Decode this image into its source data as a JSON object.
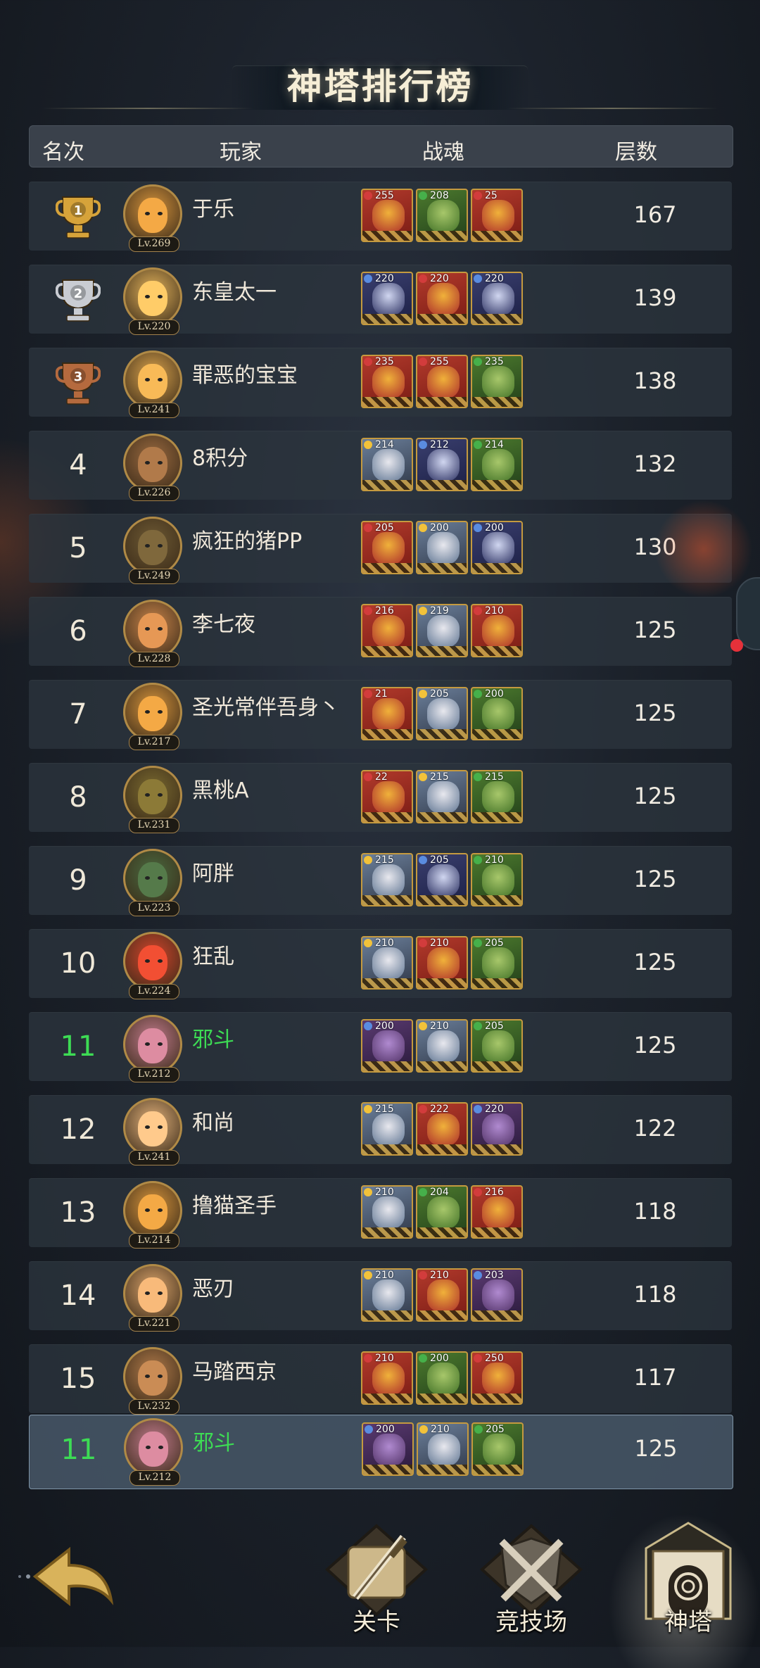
{
  "title": "神塔排行榜",
  "columns": {
    "rank": "名次",
    "player": "玩家",
    "souls": "战魂",
    "floors": "层数"
  },
  "rows": [
    {
      "rank": "1",
      "name": "于乐",
      "level": "Lv.269",
      "floor": "167",
      "souls": [
        "255",
        "208",
        "25"
      ]
    },
    {
      "rank": "2",
      "name": "东皇太一",
      "level": "Lv.220",
      "floor": "139",
      "souls": [
        "220",
        "220",
        "220"
      ]
    },
    {
      "rank": "3",
      "name": "罪恶的宝宝",
      "level": "Lv.241",
      "floor": "138",
      "souls": [
        "235",
        "255",
        "235"
      ]
    },
    {
      "rank": "4",
      "name": "8积分",
      "level": "Lv.226",
      "floor": "132",
      "souls": [
        "214",
        "212",
        "214"
      ]
    },
    {
      "rank": "5",
      "name": "疯狂的猪PP",
      "level": "Lv.249",
      "floor": "130",
      "souls": [
        "205",
        "200",
        "200"
      ]
    },
    {
      "rank": "6",
      "name": "李七夜",
      "level": "Lv.228",
      "floor": "125",
      "souls": [
        "216",
        "219",
        "210"
      ]
    },
    {
      "rank": "7",
      "name": "圣光常伴吾身丶",
      "level": "Lv.217",
      "floor": "125",
      "souls": [
        "21",
        "205",
        "200"
      ]
    },
    {
      "rank": "8",
      "name": "黑桃A",
      "level": "Lv.231",
      "floor": "125",
      "souls": [
        "22",
        "215",
        "215"
      ]
    },
    {
      "rank": "9",
      "name": "阿胖",
      "level": "Lv.223",
      "floor": "125",
      "souls": [
        "215",
        "205",
        "210"
      ]
    },
    {
      "rank": "10",
      "name": "狂乱",
      "level": "Lv.224",
      "floor": "125",
      "souls": [
        "210",
        "210",
        "205"
      ]
    },
    {
      "rank": "11",
      "name": "邪斗",
      "level": "Lv.212",
      "floor": "125",
      "souls": [
        "200",
        "210",
        "205"
      ],
      "self": true
    },
    {
      "rank": "12",
      "name": "和尚",
      "level": "Lv.241",
      "floor": "122",
      "souls": [
        "215",
        "222",
        "220"
      ]
    },
    {
      "rank": "13",
      "name": "撸猫圣手",
      "level": "Lv.214",
      "floor": "118",
      "souls": [
        "210",
        "204",
        "216"
      ]
    },
    {
      "rank": "14",
      "name": "恶刃",
      "level": "Lv.221",
      "floor": "118",
      "souls": [
        "210",
        "210",
        "203"
      ]
    },
    {
      "rank": "15",
      "name": "马踏西京",
      "level": "Lv.232",
      "floor": "117",
      "souls": [
        "210",
        "200",
        "250"
      ]
    }
  ],
  "my_row": {
    "rank": "11",
    "name": "邪斗",
    "level": "Lv.212",
    "floor": "125",
    "souls": [
      "200",
      "210",
      "205"
    ]
  },
  "nav": {
    "level": "关卡",
    "arena": "竞技场",
    "tower": "神塔"
  },
  "colors": {
    "self_green": "#3ddc54",
    "gold": "#d6a33a",
    "silver": "#c9ccd2",
    "bronze": "#b56a3e"
  }
}
